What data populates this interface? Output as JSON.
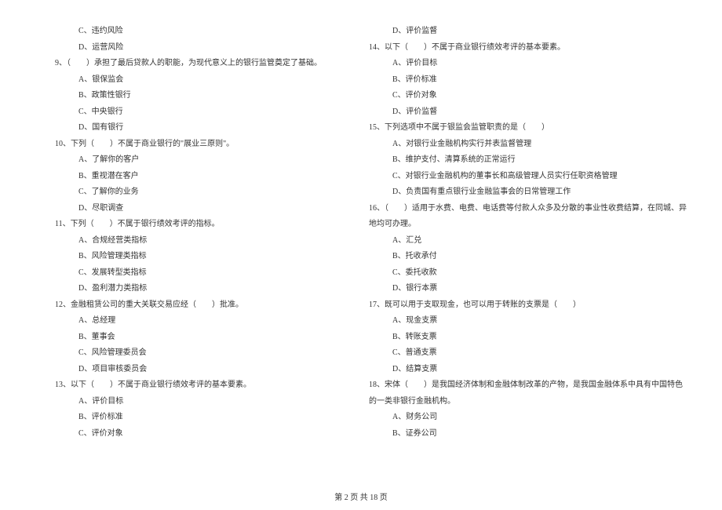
{
  "left": {
    "pre_opts": [
      "C、违约风险",
      "D、运营风险"
    ],
    "q9": "9、（　　）承担了最后贷款人的职能，为现代意义上的银行监管奠定了基础。",
    "q9_opts": [
      "A、银保监会",
      "B、政策性银行",
      "C、中央银行",
      "D、国有银行"
    ],
    "q10": "10、下列（　　）不属于商业银行的\"展业三原则\"。",
    "q10_opts": [
      "A、了解你的客户",
      "B、重视潜在客户",
      "C、了解你的业务",
      "D、尽职调查"
    ],
    "q11": "11、下列（　　）不属于银行绩效考评的指标。",
    "q11_opts": [
      "A、合规经营类指标",
      "B、风险管理类指标",
      "C、发展转型类指标",
      "D、盈利潜力类指标"
    ],
    "q12": "12、金融租赁公司的重大关联交易应经（　　）批准。",
    "q12_opts": [
      "A、总经理",
      "B、董事会",
      "C、风险管理委员会",
      "D、项目审核委员会"
    ],
    "q13": "13、以下（　　）不属于商业银行绩效考评的基本要素。",
    "q13_opts": [
      "A、评价目标",
      "B、评价标准",
      "C、评价对象"
    ]
  },
  "right": {
    "pre_opts": [
      "D、评价监督"
    ],
    "q14": "14、以下（　　）不属于商业银行绩效考评的基本要素。",
    "q14_opts": [
      "A、评价目标",
      "B、评价标准",
      "C、评价对象",
      "D、评价监督"
    ],
    "q15": "15、下列选项中不属于银监会监管职责的是（　　）",
    "q15_opts": [
      "A、对银行业金融机构实行并表监督管理",
      "B、维护支付、清算系统的正常运行",
      "C、对银行业金融机构的董事长和高级管理人员实行任职资格管理",
      "D、负责国有重点银行业金融监事会的日常管理工作"
    ],
    "q16": "16、（　　）适用于水费、电费、电话费等付款人众多及分散的事业性收费结算，在同城、异",
    "q16_cont": "地均可办理。",
    "q16_opts": [
      "A、汇兑",
      "B、托收承付",
      "C、委托收款",
      "D、银行本票"
    ],
    "q17": "17、既可以用于支取现金，也可以用于转账的支票是（　　）",
    "q17_opts": [
      "A、现金支票",
      "B、转账支票",
      "C、普通支票",
      "D、结算支票"
    ],
    "q18": "18、宋体（　　）是我国经济体制和金融体制改革的产物，是我国金融体系中具有中国特色",
    "q18_cont": "的一类非银行金融机构。",
    "q18_opts": [
      "A、财务公司",
      "B、证券公司"
    ]
  },
  "footer": "第 2 页 共 18 页"
}
